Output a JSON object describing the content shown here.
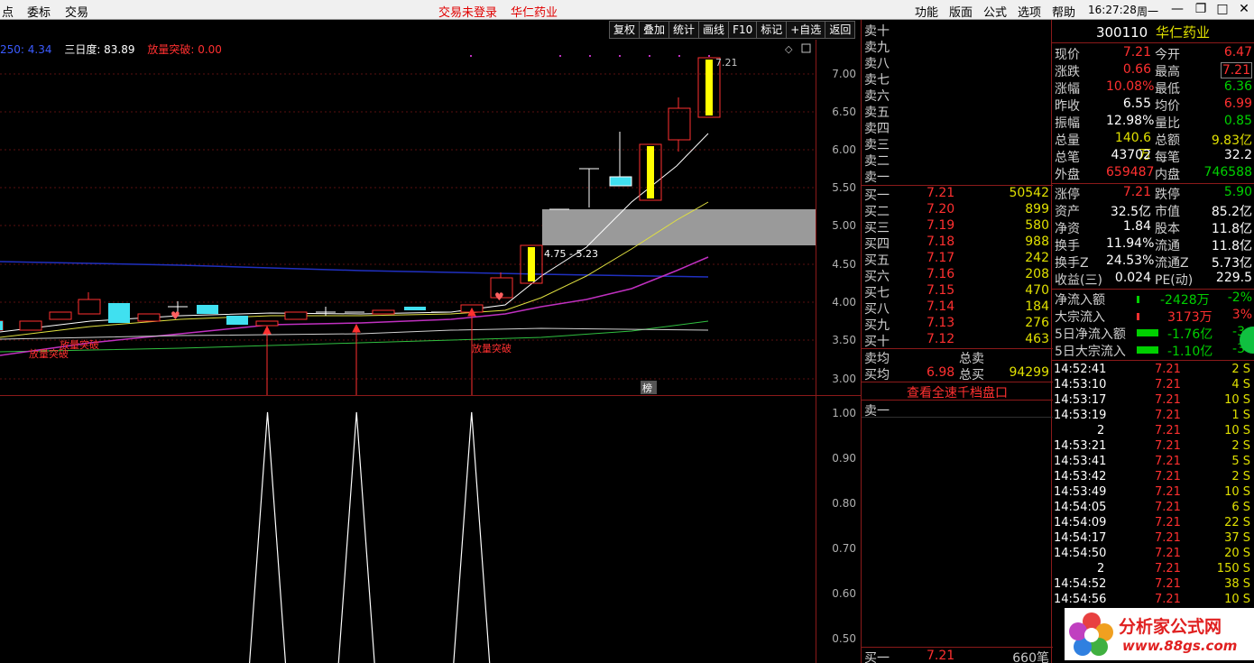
{
  "menu": {
    "left_items": [
      "点",
      "委标",
      "交易"
    ],
    "center_status": "交易未登录",
    "center_stock": "华仁药业",
    "right_items": [
      "功能",
      "版面",
      "公式",
      "选项",
      "帮助"
    ],
    "time": "16:27:28",
    "weekday": "周一"
  },
  "toolbar": [
    "复权",
    "叠加",
    "统计",
    "画线",
    "F10",
    "标记",
    "+自选",
    "返回"
  ],
  "legend": {
    "ma": "250: 4.34",
    "sanri": "三日度: 83.89",
    "breakout": "放量突破: 0.00"
  },
  "chart": {
    "price_axis": [
      "7.00",
      "6.50",
      "6.00",
      "5.50",
      "5.00",
      "4.50",
      "4.00",
      "3.50",
      "3.00"
    ],
    "high_label": "7.21",
    "range_label": "4.75 - 5.23",
    "signal_labels": [
      "放量突破",
      "放量突破",
      "放量突破"
    ],
    "bang": "榜"
  },
  "sub_axis": [
    "1.00",
    "0.90",
    "0.80",
    "0.70",
    "0.60",
    "0.50"
  ],
  "orderbook": {
    "sell": [
      {
        "label": "卖十"
      },
      {
        "label": "卖九"
      },
      {
        "label": "卖八"
      },
      {
        "label": "卖七"
      },
      {
        "label": "卖六"
      },
      {
        "label": "卖五"
      },
      {
        "label": "卖四"
      },
      {
        "label": "卖三"
      },
      {
        "label": "卖二"
      },
      {
        "label": "卖一"
      }
    ],
    "buy": [
      {
        "label": "买一",
        "price": "7.21",
        "vol": "50542"
      },
      {
        "label": "买二",
        "price": "7.20",
        "vol": "899"
      },
      {
        "label": "买三",
        "price": "7.19",
        "vol": "580"
      },
      {
        "label": "买四",
        "price": "7.18",
        "vol": "988"
      },
      {
        "label": "买五",
        "price": "7.17",
        "vol": "242"
      },
      {
        "label": "买六",
        "price": "7.16",
        "vol": "208"
      },
      {
        "label": "买七",
        "price": "7.15",
        "vol": "470"
      },
      {
        "label": "买八",
        "price": "7.14",
        "vol": "184"
      },
      {
        "label": "买九",
        "price": "7.13",
        "vol": "276"
      },
      {
        "label": "买十",
        "price": "7.12",
        "vol": "463"
      }
    ],
    "avg_sell_label": "卖均",
    "total_sell_label": "总卖",
    "avg_buy_label": "买均",
    "avg_buy": "6.98",
    "total_buy_label": "总买",
    "total_buy": "94299",
    "deep_link": "查看全速千档盘口",
    "deep_sell1": "卖一",
    "bottom_buy_label": "买一",
    "bottom_buy_price": "7.21",
    "bottom_buy_vol": "660笔"
  },
  "quote": {
    "code": "300110",
    "name": "华仁药业",
    "rows": [
      {
        "k": "现价",
        "v": "7.21",
        "vc": "red",
        "k2": "今开",
        "v2": "6.47",
        "v2c": "red"
      },
      {
        "k": "涨跌",
        "v": "0.66",
        "vc": "red",
        "k2": "最高",
        "v2": "7.21",
        "v2c": "red"
      },
      {
        "k": "涨幅",
        "v": "10.08%",
        "vc": "red",
        "k2": "最低",
        "v2": "6.36",
        "v2c": "grn"
      },
      {
        "k": "昨收",
        "v": "6.55",
        "vc": "wht",
        "k2": "均价",
        "v2": "6.99",
        "v2c": "red"
      },
      {
        "k": "振幅",
        "v": "12.98%",
        "vc": "wht",
        "k2": "量比",
        "v2": "0.85",
        "v2c": "grn"
      },
      {
        "k": "总量",
        "v": "140.6万",
        "vc": "yel",
        "k2": "总额",
        "v2": "9.83亿",
        "v2c": "yel"
      },
      {
        "k": "总笔",
        "v": "43702",
        "vc": "wht",
        "k2": "每笔",
        "v2": "32.2",
        "v2c": "wht"
      },
      {
        "k": "外盘",
        "v": "659487",
        "vc": "red",
        "k2": "内盘",
        "v2": "746588",
        "v2c": "grn"
      }
    ],
    "rows2": [
      {
        "k": "涨停",
        "v": "7.21",
        "vc": "red",
        "k2": "跌停",
        "v2": "5.90",
        "v2c": "grn"
      },
      {
        "k": "资产",
        "v": "32.5亿",
        "vc": "wht",
        "k2": "市值",
        "v2": "85.2亿",
        "v2c": "wht"
      },
      {
        "k": "净资",
        "v": "1.84",
        "vc": "wht",
        "k2": "股本",
        "v2": "11.8亿",
        "v2c": "wht"
      },
      {
        "k": "换手",
        "v": "11.94%",
        "vc": "wht",
        "k2": "流通",
        "v2": "11.8亿",
        "v2c": "wht"
      },
      {
        "k": "换手Z",
        "v": "24.53%",
        "vc": "wht",
        "k2": "流通Z",
        "v2": "5.73亿",
        "v2c": "wht"
      },
      {
        "k": "收益(三)",
        "v": "0.024",
        "vc": "wht",
        "k2": "PE(动)",
        "v2": "229.5",
        "v2c": "wht"
      }
    ],
    "flows": [
      {
        "k": "净流入额",
        "v": "-2428万",
        "vc": "grn",
        "pct": "-2%"
      },
      {
        "k": "大宗流入",
        "v": "3173万",
        "vc": "red",
        "pct": "3%"
      },
      {
        "k": "5日净流入额",
        "v": "-1.76亿",
        "vc": "grn",
        "pct": "-3"
      },
      {
        "k": "5日大宗流入",
        "v": "-1.10亿",
        "vc": "grn",
        "pct": "-3"
      }
    ],
    "ticks": [
      {
        "t": "14:52:41",
        "p": "7.21",
        "n": "2 S"
      },
      {
        "t": "14:53:10",
        "p": "7.21",
        "n": "4 S"
      },
      {
        "t": "14:53:17",
        "p": "7.21",
        "n": "10 S"
      },
      {
        "t": "14:53:19",
        "p": "7.21",
        "n": "1 S"
      },
      {
        "t": "2",
        "p": "7.21",
        "n": "10 S"
      },
      {
        "t": "14:53:21",
        "p": "7.21",
        "n": "2 S"
      },
      {
        "t": "14:53:41",
        "p": "7.21",
        "n": "5 S"
      },
      {
        "t": "14:53:42",
        "p": "7.21",
        "n": "2 S"
      },
      {
        "t": "14:53:49",
        "p": "7.21",
        "n": "10 S"
      },
      {
        "t": "14:54:05",
        "p": "7.21",
        "n": "6 S"
      },
      {
        "t": "14:54:09",
        "p": "7.21",
        "n": "22 S"
      },
      {
        "t": "14:54:17",
        "p": "7.21",
        "n": "37 S"
      },
      {
        "t": "14:54:50",
        "p": "7.21",
        "n": "20 S"
      },
      {
        "t": "2",
        "p": "7.21",
        "n": "150 S"
      },
      {
        "t": "14:54:52",
        "p": "7.21",
        "n": "38 S"
      },
      {
        "t": "14:54:56",
        "p": "7.21",
        "n": "10 S"
      }
    ],
    "watermark": "分析家公式网",
    "watermark_url": "www.88gs.com"
  }
}
